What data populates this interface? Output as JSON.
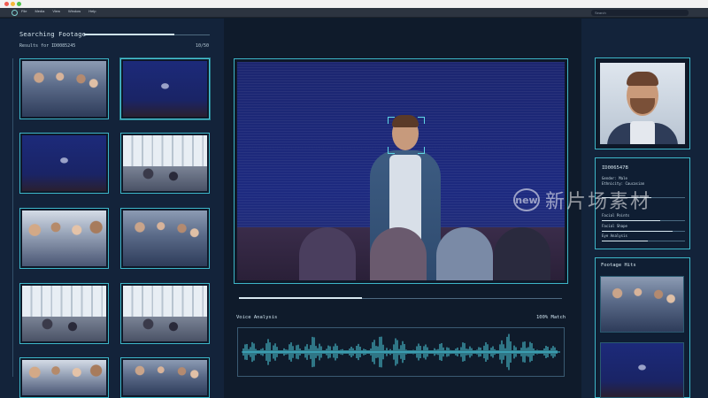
{
  "window": {
    "menu": [
      "File",
      "Media",
      "View",
      "Window",
      "Help"
    ],
    "search_placeholder": "Search"
  },
  "left": {
    "title": "Searching Footage",
    "results_label": "Results for ID0085245",
    "results_count": "10/50",
    "search_progress": 0.72
  },
  "main": {
    "voice_label": "Voice Analysis",
    "match_label": "100% Match",
    "playback_progress": 0.38
  },
  "profile": {
    "id": "ID006547B",
    "gender": "Gender: Male",
    "ethnicity": "Ethnicity: Caucasian",
    "metrics": [
      {
        "label": "Facial Points",
        "value": 0.7
      },
      {
        "label": "Facial Shape",
        "value": 0.85
      },
      {
        "label": "Eye Analysis",
        "value": 0.55
      }
    ],
    "metric_top": {
      "value": 0.6
    }
  },
  "hits": {
    "title": "Footage Hits"
  },
  "watermark": {
    "badge": "new",
    "text": "新片场素材"
  },
  "colors": {
    "accent": "#3db6c8",
    "background": "#0f1b2b",
    "panel": "#13233a"
  }
}
